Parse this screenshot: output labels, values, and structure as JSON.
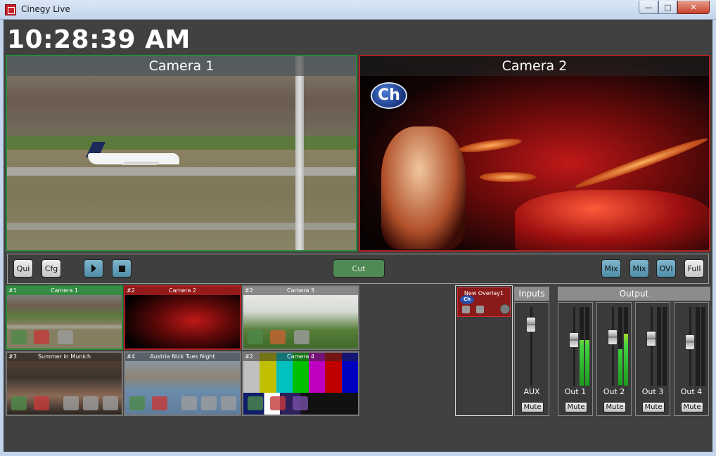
{
  "window": {
    "title": "Cinegy Live",
    "minimize": "—",
    "maximize": "□",
    "close": "✕"
  },
  "clock": "10:28:39 AM",
  "monitors": {
    "preview_label": "Camera 1",
    "program_label": "Camera 2",
    "logo_text": "Ch"
  },
  "controls": {
    "qui": "Qui",
    "cfg": "Cfg",
    "cut": "Cut",
    "mix1": "Mix",
    "mix2": "Mix",
    "ovl": "OVl",
    "full": "Full"
  },
  "sources": [
    {
      "num": "#1",
      "title": "Camera 1"
    },
    {
      "num": "#2",
      "title": "Camera 2"
    },
    {
      "num": "#2",
      "title": "Camera 3"
    },
    {
      "num": "#3",
      "title": "Summer in Munich"
    },
    {
      "num": "#4",
      "title": "Austria Nick Tues Night"
    },
    {
      "num": "#2",
      "title": "Camera 4"
    }
  ],
  "overlay": {
    "title": "New Overlay1",
    "logo_text": "Ch",
    "btn1": "-",
    "btn2": "-"
  },
  "audio": {
    "inputs_header": "Inputs",
    "output_header": "Output",
    "mute_label": "Mute",
    "strips": [
      {
        "name": "AUX",
        "fader_level": 0.78,
        "meter_left": 0,
        "meter_right": 0
      },
      {
        "name": "Out 1",
        "fader_level": 0.58,
        "meter_left": 0.58,
        "meter_right": 0.58
      },
      {
        "name": "Out 2",
        "fader_level": 0.62,
        "meter_left": 0.46,
        "meter_right": 0.66
      },
      {
        "name": "Out 3",
        "fader_level": 0.6,
        "meter_left": 0,
        "meter_right": 0
      },
      {
        "name": "Out 4",
        "fader_level": 0.55,
        "meter_left": 0,
        "meter_right": 0
      }
    ]
  },
  "colors": {
    "preview_tally": "#2a8a3a",
    "program_tally": "#b02020",
    "accent_blue": "#4f8ea8"
  }
}
